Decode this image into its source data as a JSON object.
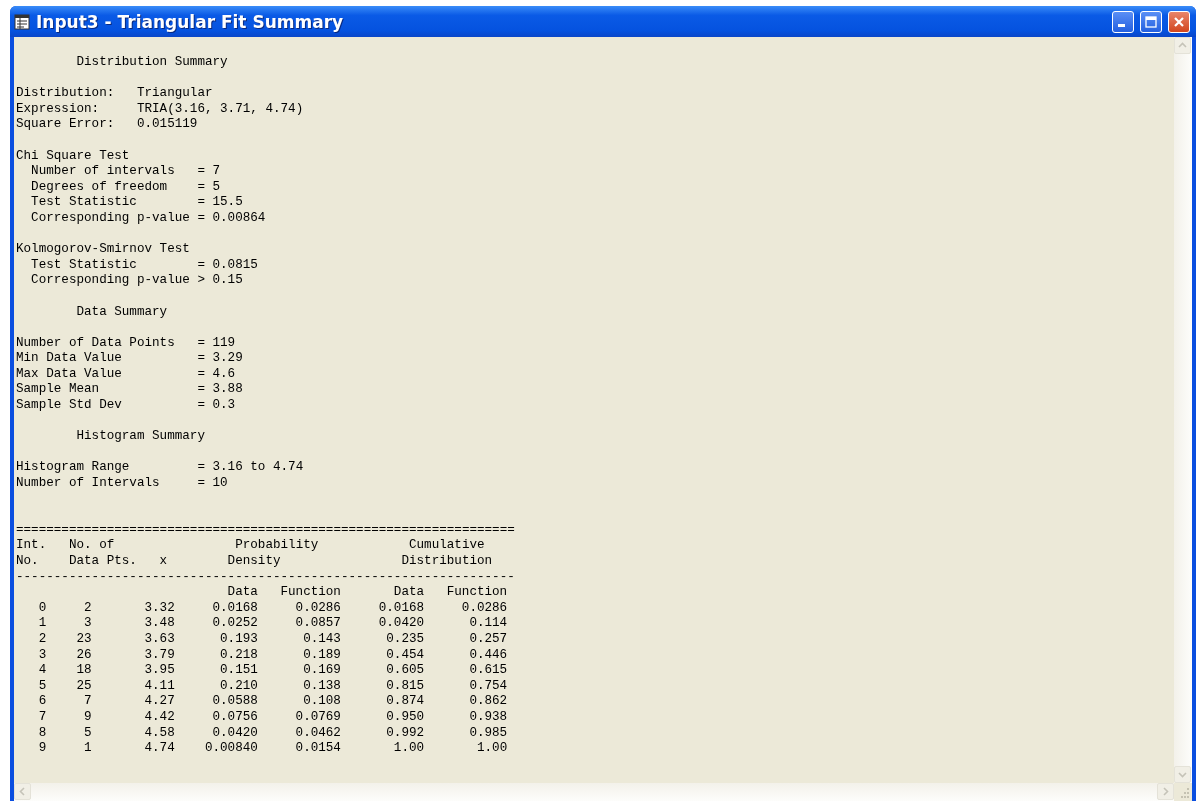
{
  "window": {
    "title": "Input3 - Triangular Fit Summary"
  },
  "report": {
    "blocks": [
      {
        "lines": [
          "        Distribution Summary"
        ]
      },
      {
        "lines": [
          "Distribution:   Triangular",
          "Expression:     TRIA(3.16, 3.71, 4.74)",
          "Square Error:   0.015119"
        ]
      },
      {
        "lines": [
          "Chi Square Test",
          "  Number of intervals   = 7",
          "  Degrees of freedom    = 5",
          "  Test Statistic        = 15.5",
          "  Corresponding p-value = 0.00864"
        ]
      },
      {
        "lines": [
          "Kolmogorov-Smirnov Test",
          "  Test Statistic        = 0.0815",
          "  Corresponding p-value > 0.15"
        ]
      },
      {
        "lines": [
          "        Data Summary"
        ]
      },
      {
        "lines": [
          "Number of Data Points   = 119",
          "Min Data Value          = 3.29",
          "Max Data Value          = 4.6",
          "Sample Mean             = 3.88",
          "Sample Std Dev          = 0.3"
        ]
      },
      {
        "lines": [
          "        Histogram Summary"
        ]
      },
      {
        "lines": [
          "Histogram Range         = 3.16 to 4.74",
          "Number of Intervals     = 10"
        ]
      }
    ],
    "table": {
      "rule_top": "==================================================================",
      "header_lines": [
        "Int.   No. of                Probability            Cumulative",
        "No.    Data Pts.   x        Density                Distribution"
      ],
      "rule_mid": "------------------------------------------------------------------",
      "subheader": [
        "Data",
        "Function",
        "Data",
        "Function"
      ],
      "rows": [
        [
          "0",
          "2",
          "3.32",
          "0.0168",
          "0.0286",
          "0.0168",
          "0.0286"
        ],
        [
          "1",
          "3",
          "3.48",
          "0.0252",
          "0.0857",
          "0.0420",
          "0.114"
        ],
        [
          "2",
          "23",
          "3.63",
          "0.193",
          "0.143",
          "0.235",
          "0.257"
        ],
        [
          "3",
          "26",
          "3.79",
          "0.218",
          "0.189",
          "0.454",
          "0.446"
        ],
        [
          "4",
          "18",
          "3.95",
          "0.151",
          "0.169",
          "0.605",
          "0.615"
        ],
        [
          "5",
          "25",
          "4.11",
          "0.210",
          "0.138",
          "0.815",
          "0.754"
        ],
        [
          "6",
          "7",
          "4.27",
          "0.0588",
          "0.108",
          "0.874",
          "0.862"
        ],
        [
          "7",
          "9",
          "4.42",
          "0.0756",
          "0.0769",
          "0.950",
          "0.938"
        ],
        [
          "8",
          "5",
          "4.58",
          "0.0420",
          "0.0462",
          "0.992",
          "0.985"
        ],
        [
          "9",
          "1",
          "4.74",
          "0.00840",
          "0.0154",
          "1.00",
          "1.00"
        ]
      ]
    }
  }
}
